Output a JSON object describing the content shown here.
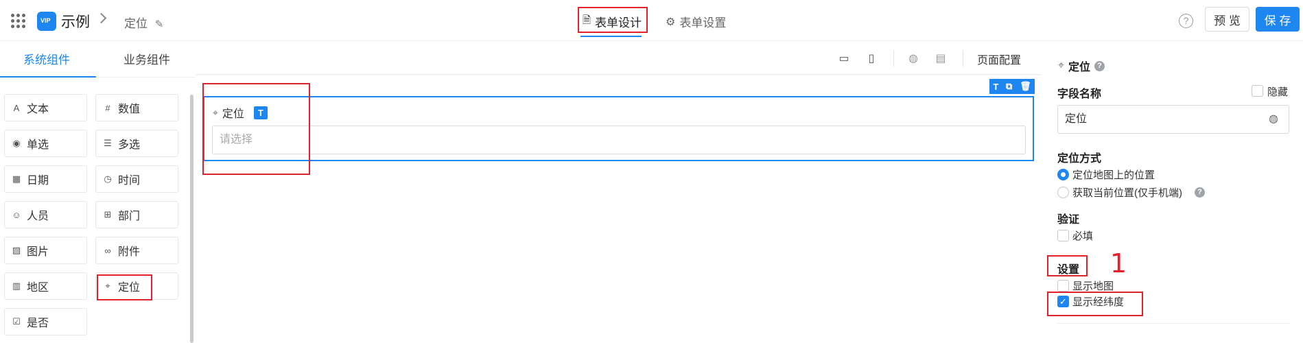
{
  "header": {
    "app_name": "示例",
    "logo_text": "VIP",
    "breadcrumb": "定位",
    "tabs": [
      {
        "label": "表单设计",
        "icon": "document-icon"
      },
      {
        "label": "表单设置",
        "icon": "gear-icon"
      }
    ],
    "help": "?",
    "preview_label": "预 览",
    "save_label": "保 存"
  },
  "left_panel": {
    "tabs": [
      "系统组件",
      "业务组件"
    ],
    "components": [
      {
        "label": "文本",
        "icon": "A"
      },
      {
        "label": "数值",
        "icon": "#"
      },
      {
        "label": "单选",
        "icon": "◉"
      },
      {
        "label": "多选",
        "icon": "☰"
      },
      {
        "label": "日期",
        "icon": "▦"
      },
      {
        "label": "时间",
        "icon": "◷"
      },
      {
        "label": "人员",
        "icon": "☺"
      },
      {
        "label": "部门",
        "icon": "⊞"
      },
      {
        "label": "图片",
        "icon": "▨"
      },
      {
        "label": "附件",
        "icon": "∞"
      },
      {
        "label": "地区",
        "icon": "▥"
      },
      {
        "label": "定位",
        "icon": "⌖"
      },
      {
        "label": "是否",
        "icon": "☑"
      }
    ]
  },
  "canvas": {
    "page_config_label": "页面配置",
    "field": {
      "label": "定位",
      "badge": "T",
      "placeholder": "请选择"
    }
  },
  "right_panel": {
    "title": "定位",
    "field_name_label": "字段名称",
    "hide_label": "隐藏",
    "field_name_value": "定位",
    "locate_mode_label": "定位方式",
    "locate_options": [
      "定位地图上的位置",
      "获取当前位置(仅手机端)"
    ],
    "validate_label": "验证",
    "required_label": "必填",
    "settings_label": "设置",
    "show_map_label": "显示地图",
    "show_latlng_label": "显示经纬度"
  },
  "annotation": {
    "number": "1"
  },
  "colors": {
    "accent": "#1d86f0",
    "annotation_red": "#e3212a"
  }
}
